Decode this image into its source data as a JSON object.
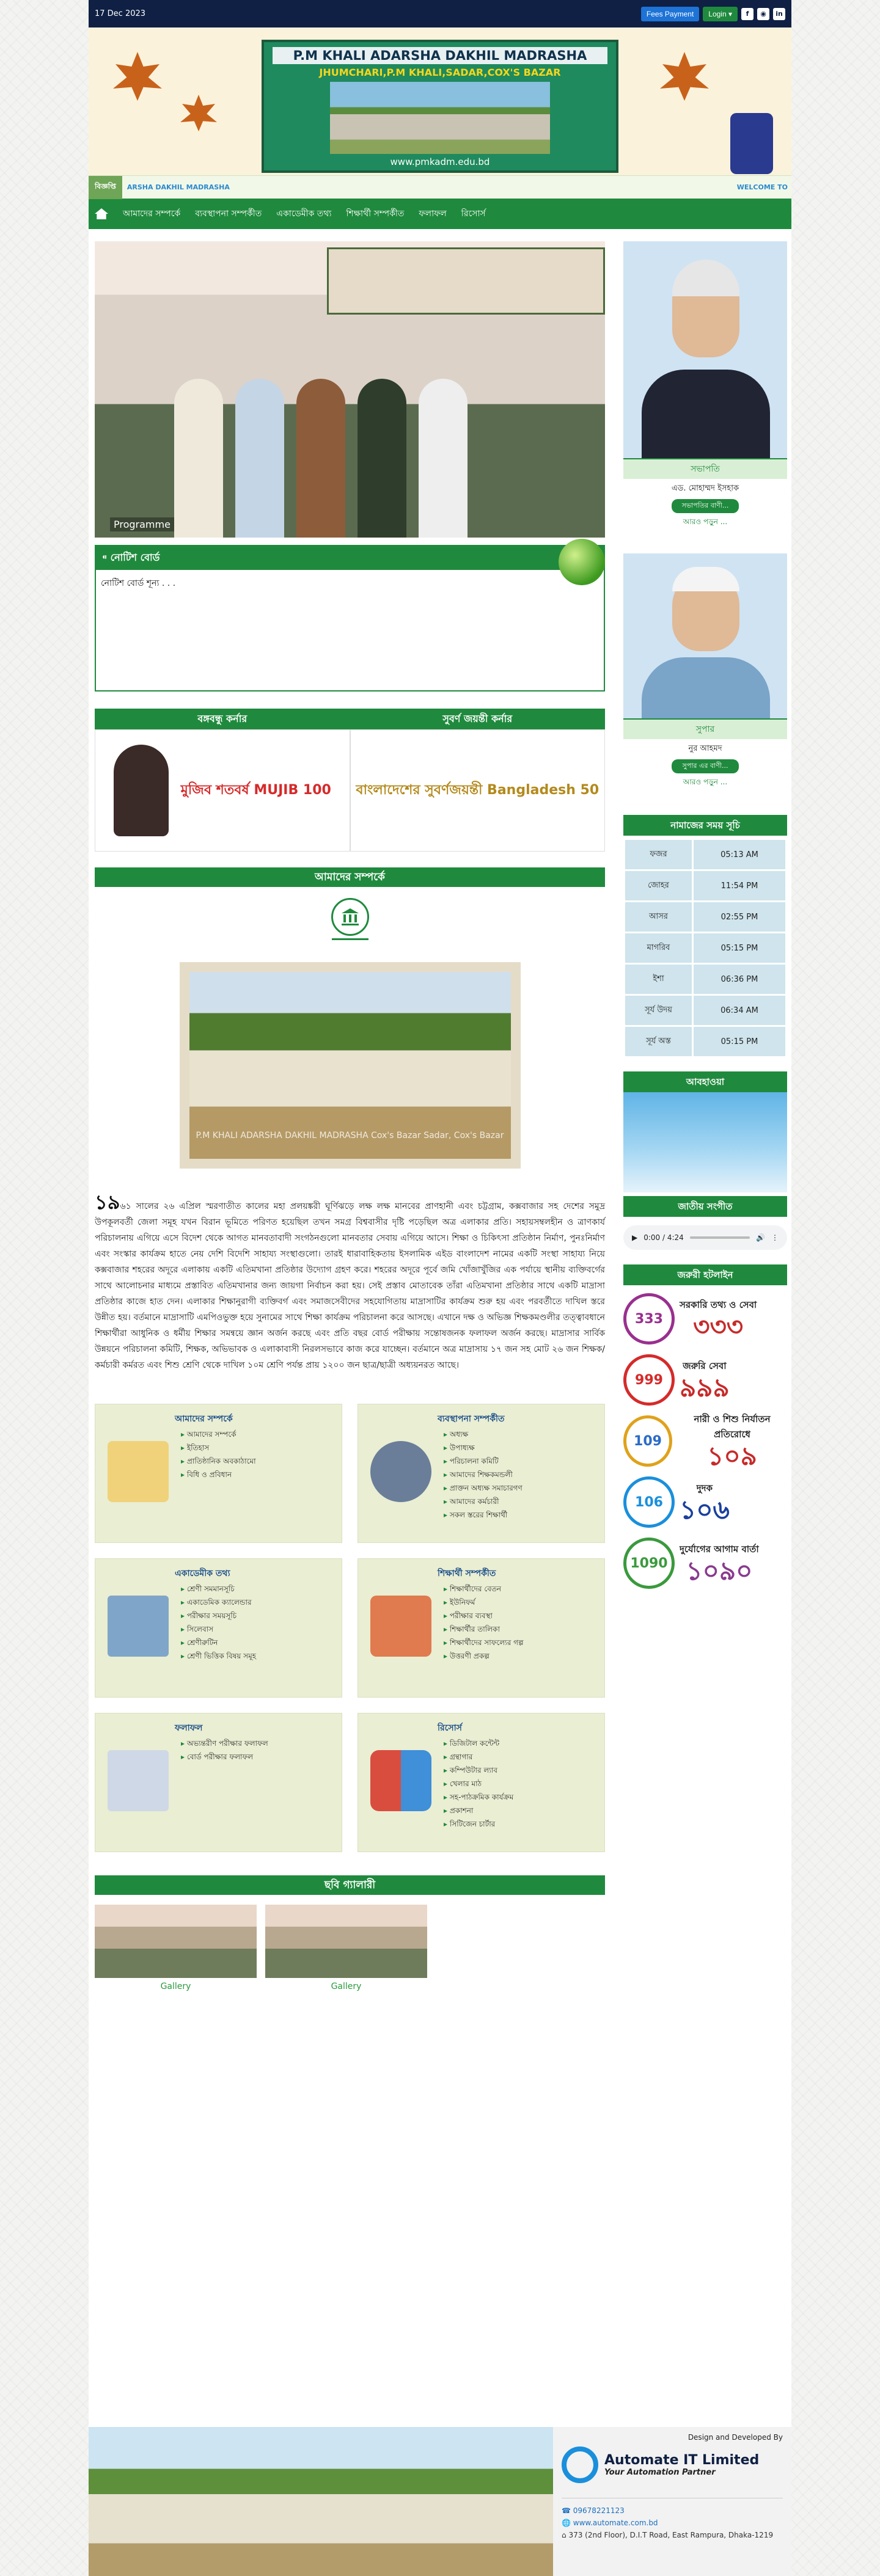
{
  "topbar": {
    "date": "17 Dec 2023",
    "fees_label": "Fees Payment",
    "login_label": "Login ▾",
    "social": [
      "f",
      "◉",
      "in"
    ]
  },
  "banner": {
    "title": "P.M KHALI ADARSHA DAKHIL MADRASHA",
    "subtitle": "JHUMCHARI,P.M KHALI,SADAR,COX'S BAZAR",
    "url": "www.pmkadm.edu.bd"
  },
  "ticker": {
    "label": "বিজ্ঞপ্তি",
    "left_text": "ARSHA DAKHIL MADRASHA",
    "right_text": "WELCOME TO"
  },
  "nav": [
    "আমাদের সম্পর্কে",
    "ব্যবস্থাপনা সম্পর্কীত",
    "একাডেমীক তথ্য",
    "শিক্ষার্থী সম্পর্কীত",
    "ফলাফল",
    "রিসোর্স"
  ],
  "slider": {
    "caption": "Programme"
  },
  "notice": {
    "title": "নোটিশ বোর্ড",
    "empty": "নোটিশ বোর্ড শূন্য . . ."
  },
  "corners": {
    "left_title": "বঙ্গবন্ধু কর্নার",
    "right_title": "সুবর্ণ জয়ন্তী কর্নার",
    "left_logo": "মুজিব শতবর্ষ MUJIB 100",
    "right_logo": "বাংলাদেশের সুবর্ণজয়ন্তী Bangladesh 50"
  },
  "about": {
    "title": "আমাদের সম্পর্কে",
    "photo_caption": "P.M KHALI ADARSHA DAKHIL MADRASHA Cox's Bazar Sadar, Cox's Bazar",
    "first": "১৯",
    "text": "৬১ সালের ২৬ এপ্রিল স্মরণাতীত কালের মহা প্রলয়ঙ্করী ঘূর্ণিঝড়ে লক্ষ লক্ষ মানবের প্রাণহানী এবং চট্টগ্রাম, কক্সবাজার সহ দেশের সমুদ্র উপকূলবর্তী জেলা সমূহ যখন বিরান ভূমিতে পরিণত হয়েছিল তখন সমগ্র বিশ্ববাসীর দৃষ্টি পড়েছিল অত্র এলাকার প্রতি। সহায়সম্বলহীন ও ত্রাণকার্য পরিচালনায় এগিয়ে এসে বিদেশ থেকে আগত মানবতাবাদী সংগঠনগুলো মানবতার সেবায় এগিয়ে আসে। শিক্ষা ও চিকিৎসা প্রতিষ্ঠান নির্মাণ, পুনঃনির্মাণ এবং সংস্কার কার্যক্রম হাতে নেয় দেশি বিদেশি সাহায্য সংস্থাগুলো। তারই ধারাবাহিকতায় ইসলামিক এইড বাংলাদেশ নামের একটি সংস্থা সাহায্য নিয়ে কক্সবাজার শহরের অদূরে এলাকায় একটি এতিমখানা প্রতিষ্ঠার উদ্যোগ গ্রহণ করে। শহরের অদূরে পূর্বে জমি খোঁজাখুঁজির এক পর্যায়ে স্থানীয় ব্যক্তিবর্গের সাথে আলোচনার মাধ্যমে প্রস্তাবিত এতিমখানার জন্য জায়গা নির্বাচন করা হয়। সেই প্রস্তাব মোতাবেক তাঁরা এতিমখানা প্রতিষ্ঠার সাথে একটি মাদ্রাসা প্রতিষ্ঠার কাজে হাত দেন। এলাকার শিক্ষানুরাগী ব্যক্তিবর্গ এবং সমাজসেবীদের সহযোগিতায় মাদ্রাসাটির কার্যক্রম শুরু হয় এবং পরবর্তীতে দাখিল স্তরে উন্নীত হয়। বর্তমানে মাদ্রাসাটি এমপিওভুক্ত হয়ে সুনামের সাথে শিক্ষা কার্যক্রম পরিচালনা করে আসছে। এখানে দক্ষ ও অভিজ্ঞ শিক্ষকমণ্ডলীর তত্ত্বাবধানে শিক্ষার্থীরা আধুনিক ও ধর্মীয় শিক্ষার সমন্বয়ে জ্ঞান অর্জন করছে এবং প্রতি বছর বোর্ড পরীক্ষায় সন্তোষজনক ফলাফল অর্জন করছে। মাদ্রাসার সার্বিক উন্নয়নে পরিচালনা কমিটি, শিক্ষক, অভিভাবক ও এলাকাবাসী নিরলসভাবে কাজ করে যাচ্ছেন। বর্তমানে অত্র মাদ্রাসায় ১৭ জন সহ মোট ২৬ জন শিক্ষক/কর্মচারী কর্মরত এবং শিশু শ্রেণি থেকে দাখিল ১০ম শ্রেণি পর্যন্ত প্রায় ১২০০ জন ছাত্র/ছাত্রী অধ্যয়নরত আছে।"
  },
  "cards": [
    {
      "title": "আমাদের সম্পর্কে",
      "items": [
        "আমাদের সম্পর্কে",
        "ইতিহাস",
        "প্রাতিষ্ঠানিক অবকাঠামো",
        "বিধি ও প্রবিধান"
      ]
    },
    {
      "title": "ব্যবস্থাপনা সম্পর্কীত",
      "items": [
        "অধ্যক্ষ",
        "উপাধ্যক্ষ",
        "পরিচালনা কমিটি",
        "আমাদের শিক্ষকমন্ডলী",
        "প্রাক্তন অধ্যক্ষ সমাচারগণ",
        "আমাদের কর্মচারী",
        "সকল স্তরের শিক্ষার্থী"
      ]
    },
    {
      "title": "একাডেমীক তথ্য",
      "items": [
        "শ্রেণী সমমানসূচি",
        "একাডেমিক ক্যালেন্ডার",
        "পরীক্ষার সময়সূচি",
        "সিলেবাস",
        "শ্রেণীরুটিন",
        "শ্রেণী ভিত্তিক বিষয় সমূহ"
      ]
    },
    {
      "title": "শিক্ষার্থী সম্পর্কীত",
      "items": [
        "শিক্ষার্থীদের বেতন",
        "ইউনিফর্ম",
        "পরীক্ষার ব্যবস্থা",
        "শিক্ষার্থীর তালিকা",
        "শিক্ষার্থীদের সাফল্যের গল্প",
        "উত্তরণী প্রকল্প"
      ]
    },
    {
      "title": "ফলাফল",
      "items": [
        "অভ্যন্তরীণ পরীক্ষার ফলাফল",
        "বোর্ড পরীক্ষার ফলাফল"
      ]
    },
    {
      "title": "রিসোর্স",
      "items": [
        "ডিজিটাল কন্টেন্ট",
        "গ্রন্থাগার",
        "কম্পিউটার ল্যাব",
        "খেলার মাঠ",
        "সহ-পাঠক্রমিক কার্যক্রম",
        "প্রকাশনা",
        "সিটিজেন চার্টার"
      ]
    }
  ],
  "gallery": {
    "title": "ছবি গ্যালারী",
    "items": [
      "Gallery",
      "Gallery"
    ]
  },
  "sidebar": {
    "president": {
      "role": "সভাপতি",
      "name": "এড. মোহাম্মদ ইসহাক",
      "pill": "সভাপতির বাণী...",
      "more": "আরও পড়ুন ..."
    },
    "super": {
      "role": "সুপার",
      "name": "নুর আহমদ",
      "pill": "সুপার এর বাণী...",
      "more": "আরও পড়ুন ..."
    },
    "prayer_title": "নামাজের সময় সূচি",
    "prayer": [
      [
        "ফজর",
        "05:13 AM"
      ],
      [
        "জোহর",
        "11:54 PM"
      ],
      [
        "আসর",
        "02:55 PM"
      ],
      [
        "মাগরিব",
        "05:15 PM"
      ],
      [
        "ইশা",
        "06:36 PM"
      ],
      [
        "সূর্য উদয়",
        "06:34 AM"
      ],
      [
        "সূর্য অস্ত",
        "05:15 PM"
      ]
    ],
    "weather_title": "আবহাওয়া",
    "anthem_title": "জাতীয় সংগীত",
    "audio_time": "0:00 / 4:24",
    "help_title": "জরুরী হটলাইন",
    "hotlines": [
      {
        "label": "সরকারি তথ্য ও সেবা",
        "num": "৩৩৩",
        "icon": "333"
      },
      {
        "label": "জরুরি সেবা",
        "num": "৯৯৯",
        "icon": "999"
      },
      {
        "label": "নারী ও শিশু নির্যাতন প্রতিরোধে",
        "num": "১০৯",
        "icon": "109"
      },
      {
        "label": "দুদক",
        "num": "১০৬",
        "icon": "106"
      },
      {
        "label": "দুর্যোগের আগাম বার্তা",
        "num": "১০৯০",
        "icon": "1090"
      }
    ]
  },
  "footer": {
    "design_label": "Design and Developed By",
    "company": "Automate IT Limited",
    "tagline": "Your Automation Partner",
    "phone": "09678221123",
    "site": "www.automate.com.bd",
    "address": "373 (2nd Floor), D.I.T Road, East Rampura, Dhaka-1219"
  }
}
